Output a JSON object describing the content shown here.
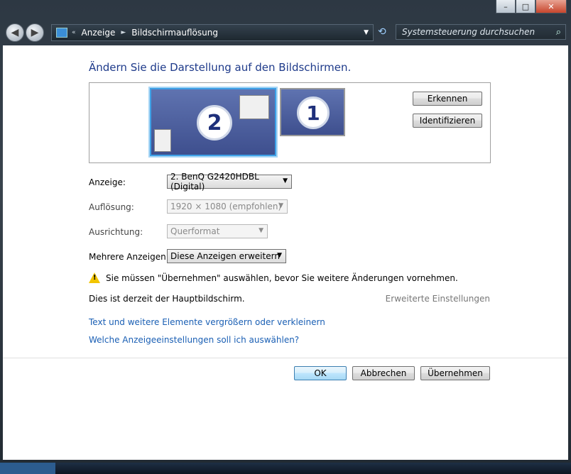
{
  "window": {
    "controls": [
      "–",
      "□",
      "✕"
    ]
  },
  "nav": {
    "back_icon": "back-arrow",
    "forward_icon": "forward-arrow",
    "breadcrumb": [
      "Anzeige",
      "Bildschirmauflösung"
    ],
    "search_placeholder": "Systemsteuerung durchsuchen",
    "chevron_sep": "«",
    "arrow_sep": "►"
  },
  "heading": "Ändern Sie die Darstellung auf den Bildschirmen.",
  "monitors": {
    "primary": "2",
    "secondary": "1"
  },
  "buttons": {
    "detect": "Erkennen",
    "identify": "Identifizieren"
  },
  "settings": {
    "display_label": "Anzeige:",
    "display_value": "2. BenQ G2420HDBL (Digital)",
    "resolution_label": "Auflösung:",
    "resolution_value": "1920 × 1080 (empfohlen)",
    "orientation_label": "Ausrichtung:",
    "orientation_value": "Querformat",
    "multi_label": "Mehrere Anzeigen:",
    "multi_value": "Diese Anzeigen erweitern"
  },
  "warning": "Sie müssen \"Übernehmen\" auswählen, bevor Sie weitere Änderungen vornehmen.",
  "primary_text": "Dies ist derzeit der Hauptbildschirm.",
  "advanced_link": "Erweiterte Einstellungen",
  "links": {
    "text_size": "Text und weitere Elemente vergrößern oder verkleinern",
    "which_settings": "Welche Anzeigeeinstellungen soll ich auswählen?"
  },
  "dialog": {
    "ok": "OK",
    "cancel": "Abbrechen",
    "apply": "Übernehmen"
  }
}
